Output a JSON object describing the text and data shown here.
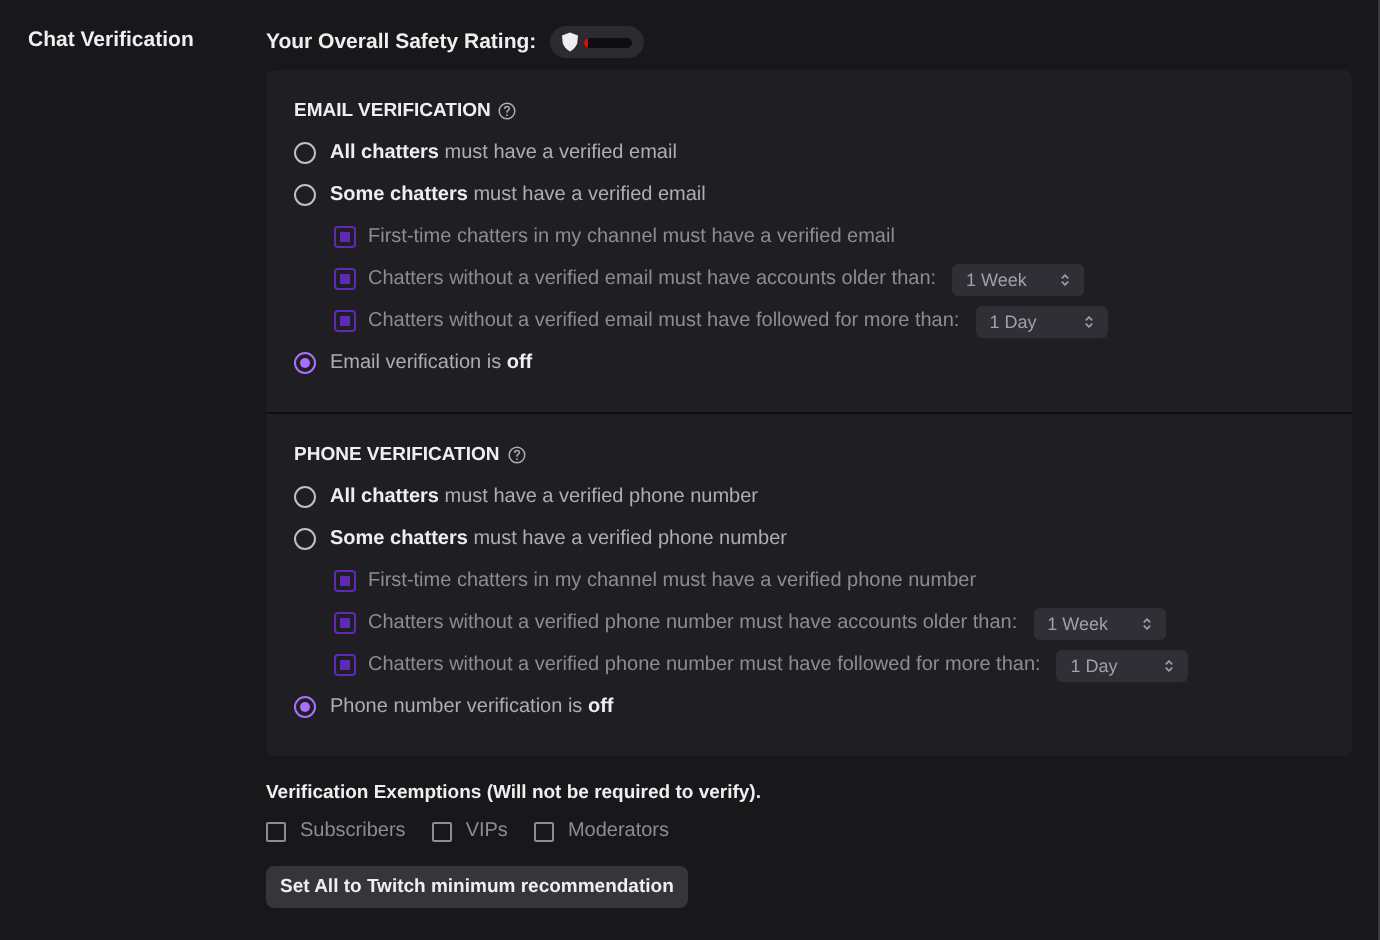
{
  "section_label": "Chat Verification",
  "safety": {
    "label": "Your Overall Safety Rating:",
    "level": 0.08
  },
  "groups": [
    {
      "title": "EMAIL VERIFICATION",
      "options": [
        {
          "kind": "radio",
          "text": "**All chatters** must have a verified email",
          "selected": false
        },
        {
          "kind": "radio",
          "text": "**Some chatters** must have a verified email",
          "selected": false
        },
        {
          "kind": "checkbox",
          "text": "First-time chatters in my channel must have a verified email",
          "checked": true,
          "disabled": true
        },
        {
          "kind": "checkbox",
          "text": "Chatters without a verified email must have accounts older than:",
          "checked": true,
          "disabled": true,
          "select": "1 Week"
        },
        {
          "kind": "checkbox",
          "text": "Chatters without a verified email must have followed for more than:",
          "checked": true,
          "disabled": true,
          "select": "1 Day"
        },
        {
          "kind": "radio",
          "text": "Email verification is **off**",
          "selected": true
        }
      ]
    },
    {
      "title": "PHONE VERIFICATION",
      "options": [
        {
          "kind": "radio",
          "text": "**All chatters** must have a verified phone number",
          "selected": false
        },
        {
          "kind": "radio",
          "text": "**Some chatters** must have a verified phone number",
          "selected": false
        },
        {
          "kind": "checkbox",
          "text": "First-time chatters in my channel must have a verified phone number",
          "checked": true,
          "disabled": true
        },
        {
          "kind": "checkbox",
          "text": "Chatters without a verified phone number must have accounts older than:",
          "checked": true,
          "disabled": true,
          "select": "1 Week"
        },
        {
          "kind": "checkbox",
          "text": "Chatters without a verified phone number must have followed for more than:",
          "checked": true,
          "disabled": true,
          "select": "1 Day"
        },
        {
          "kind": "radio",
          "text": "Phone number verification is **off**",
          "selected": true
        }
      ]
    }
  ],
  "exemptions": {
    "title": "Verification Exemptions (Will not be required to verify).",
    "items": [
      {
        "label": "Subscribers",
        "checked": false
      },
      {
        "label": "VIPs",
        "checked": false
      },
      {
        "label": "Moderators",
        "checked": false
      }
    ]
  },
  "button": "Set All to Twitch minimum recommendation"
}
